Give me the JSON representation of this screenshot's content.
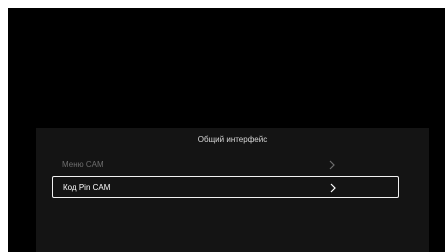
{
  "dialog": {
    "title": "Общий интерфейс",
    "items": [
      {
        "label": "Меню CAM",
        "icon": "chevron-right-icon",
        "state": "disabled"
      },
      {
        "label": "Код Pin CAM",
        "icon": "chevron-right-icon",
        "state": "focused"
      }
    ]
  },
  "colors": {
    "background": "#000000",
    "panel": "#141414",
    "disabled_text": "#6e6e6e",
    "focused_text": "#ffffff",
    "focus_border": "#f2f2f2"
  }
}
